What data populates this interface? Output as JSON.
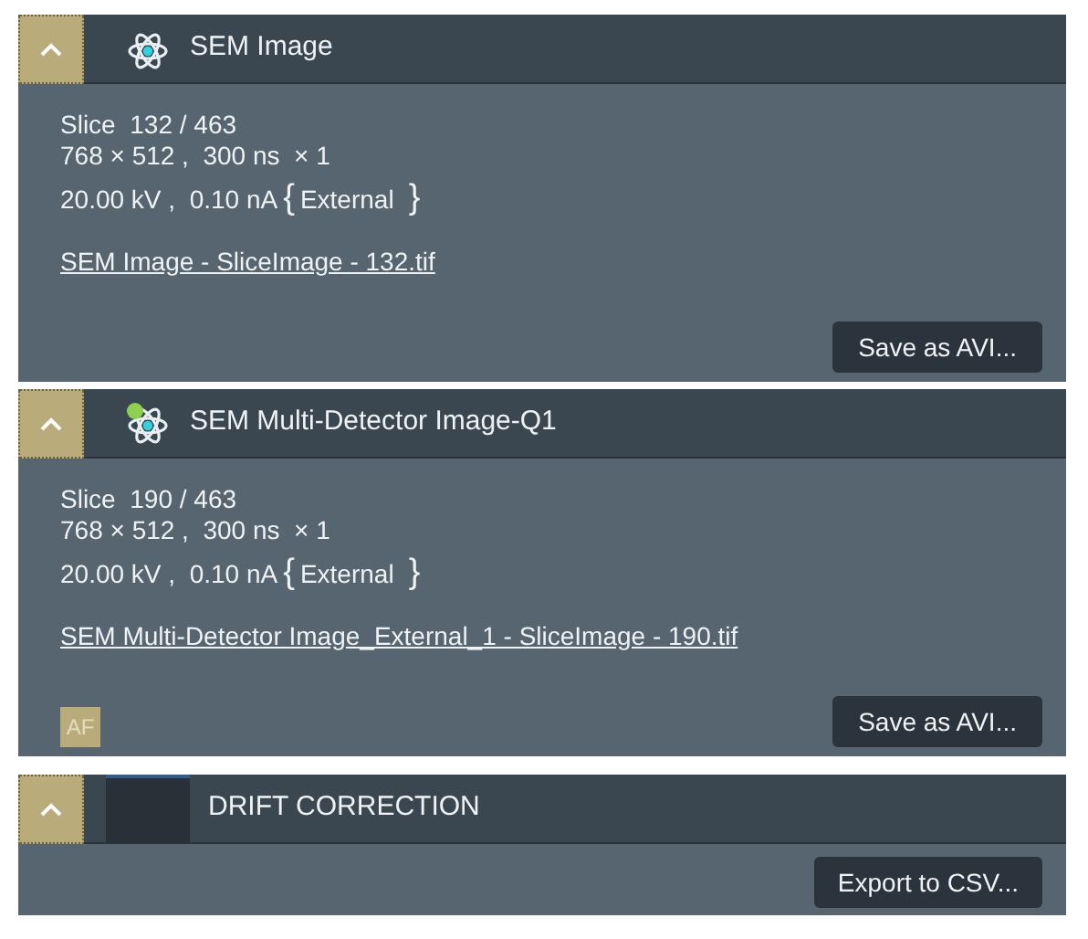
{
  "sections": [
    {
      "kind": "image",
      "title": "SEM Image",
      "expanded": true,
      "lines": [
        "Slice  132 / 463",
        "768 × 512 ,  300 ns  × 1"
      ],
      "beam": {
        "text": "20.00 kV ,  0.10 nA",
        "open_brace": "{",
        "source": "External",
        "close_brace": "}"
      },
      "file_link": "SEM Image - SliceImage - 132.tif",
      "button": "Save as AVI..."
    },
    {
      "kind": "multi-detector",
      "title": "SEM Multi-Detector Image-Q1",
      "expanded": true,
      "lines": [
        "Slice  190 / 463",
        "768 × 512 ,  300 ns  × 1"
      ],
      "beam": {
        "text": "20.00 kV ,  0.10 nA",
        "open_brace": "{",
        "source": "External",
        "close_brace": "}"
      },
      "file_link": "SEM Multi-Detector Image_External_1 - SliceImage - 190.tif",
      "badge": "AF",
      "button": "Save as AVI..."
    },
    {
      "kind": "drift",
      "title": "DRIFT CORRECTION",
      "expanded": true,
      "button": "Export to CSV..."
    }
  ]
}
